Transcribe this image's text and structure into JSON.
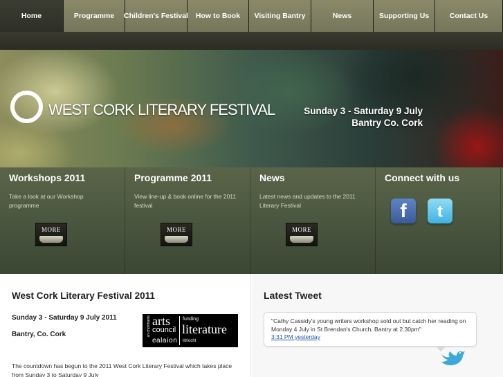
{
  "nav": {
    "items": [
      {
        "label": "Home",
        "active": true
      },
      {
        "label": "Programme",
        "active": false
      },
      {
        "label": "Children's Festival",
        "active": false
      },
      {
        "label": "How to Book",
        "active": false
      },
      {
        "label": "Visiting Bantry",
        "active": false
      },
      {
        "label": "News",
        "active": false
      },
      {
        "label": "Supporting Us",
        "active": false
      },
      {
        "label": "Contact Us",
        "active": false
      }
    ]
  },
  "hero": {
    "title": "WEST CORK LITERARY FESTIVAL",
    "dates_line1": "Sunday 3 - Saturday 9 July",
    "dates_line2": "Bantry Co. Cork"
  },
  "panels": [
    {
      "heading": "Workshops 2011",
      "text": "Take a look at our Workshop programme",
      "button": "MORE"
    },
    {
      "heading": "Programme 2011",
      "text": "View line-up & book online for the 2011 festival",
      "button": "MORE"
    },
    {
      "heading": "News",
      "text": "Latest news and updates to the 2011 Literary Festival",
      "button": "MORE"
    },
    {
      "heading": "Connect with us"
    }
  ],
  "social": {
    "facebook_glyph": "f",
    "twitter_glyph": "t",
    "facebook_icon": "facebook-icon",
    "twitter_icon": "twitter-icon"
  },
  "main": {
    "title": "West Cork Literary Festival 2011",
    "date": "Sunday 3 - Saturday 9 July 2011",
    "place": "Bantry, Co. Cork",
    "body": "The countdown has begun to the 2011 West Cork Literary Festival which takes place from Sunday 3 to Saturday 9 July"
  },
  "arts_logo": {
    "arts": "arts",
    "council": "council",
    "ealaion": "ealaíon",
    "side": "an chomhairle",
    "funding": "funding",
    "literature": "literature",
    "litriocht": "litríocht"
  },
  "tweet": {
    "heading": "Latest Tweet",
    "text": "\"Cathy Cassidy's young writers workshop sold out but catch her reading on Monday 4 July in St Brendan's Church, Bantry at 2.30pm\"",
    "time": "3:31 PM yesterday"
  }
}
